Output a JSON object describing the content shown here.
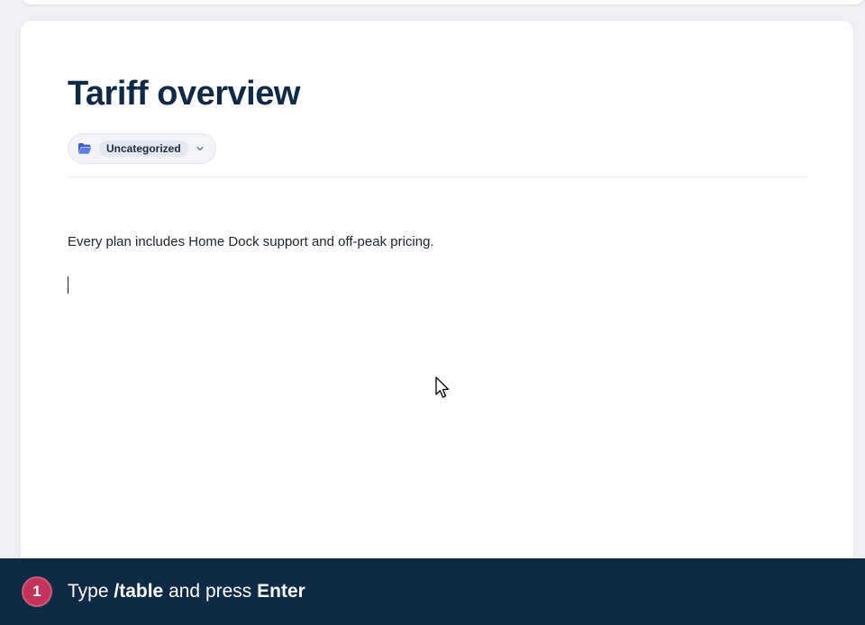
{
  "document": {
    "title": "Tariff overview",
    "category_label": "Uncategorized",
    "body_text": "Every plan includes Home Dock support and off-peak pricing."
  },
  "tutorial": {
    "step_number": "1",
    "instruction_prefix": "Type ",
    "instruction_command": "/table",
    "instruction_middle": " and press ",
    "instruction_key": "Enter"
  },
  "icons": {
    "folder": "folder-open-icon",
    "chevron": "chevron-down-icon",
    "cursor": "mouse-pointer-icon"
  },
  "colors": {
    "title": "#0f2a47",
    "footer_bg": "#0e2a47",
    "step_badge": "#c4335c",
    "folder_icon": "#3b5bdb"
  }
}
